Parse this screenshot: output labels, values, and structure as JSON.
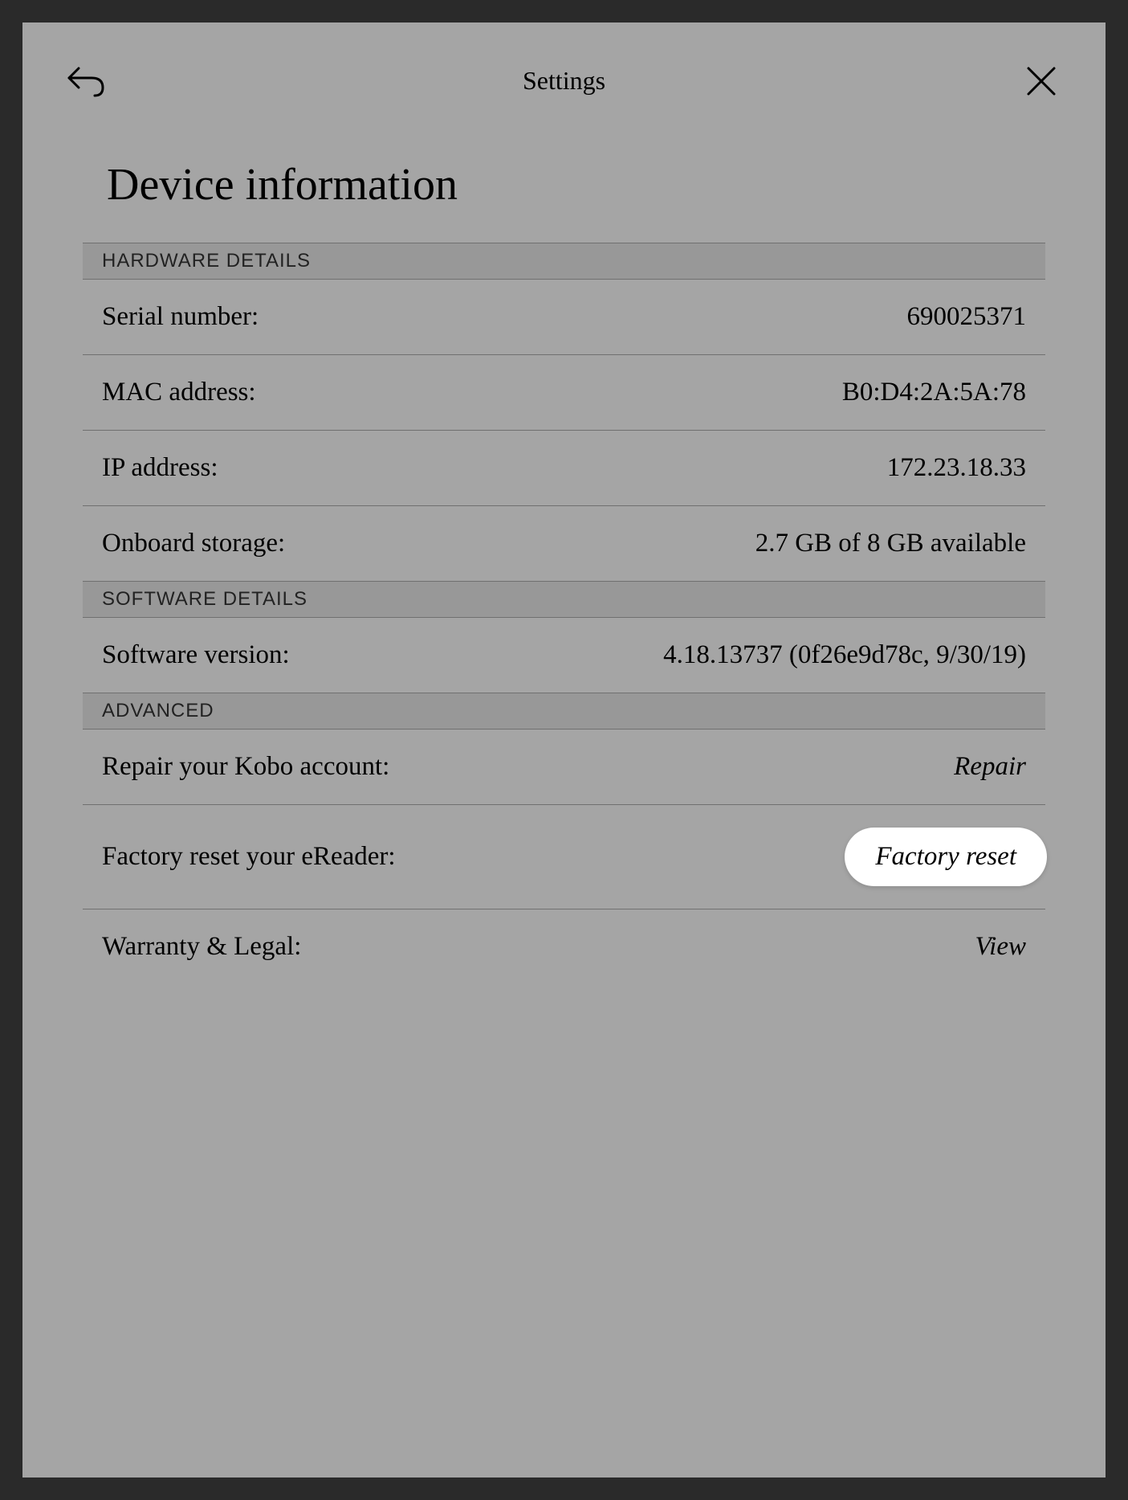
{
  "header": {
    "title": "Settings"
  },
  "page": {
    "title": "Device information"
  },
  "sections": {
    "hardware": {
      "header": "HARDWARE DETAILS",
      "serial": {
        "label": "Serial number:",
        "value": "690025371"
      },
      "mac": {
        "label": "MAC address:",
        "value": "B0:D4:2A:5A:78"
      },
      "ip": {
        "label": "IP address:",
        "value": "172.23.18.33"
      },
      "storage": {
        "label": "Onboard storage:",
        "value": "2.7 GB of 8 GB available"
      }
    },
    "software": {
      "header": "SOFTWARE DETAILS",
      "version": {
        "label": "Software version:",
        "value": "4.18.13737 (0f26e9d78c, 9/30/19)"
      }
    },
    "advanced": {
      "header": "ADVANCED",
      "repair": {
        "label": "Repair your Kobo account:",
        "action": "Repair"
      },
      "reset": {
        "label": "Factory reset your eReader:",
        "action": "Factory reset"
      },
      "warranty": {
        "label": "Warranty & Legal:",
        "action": "View"
      }
    }
  }
}
